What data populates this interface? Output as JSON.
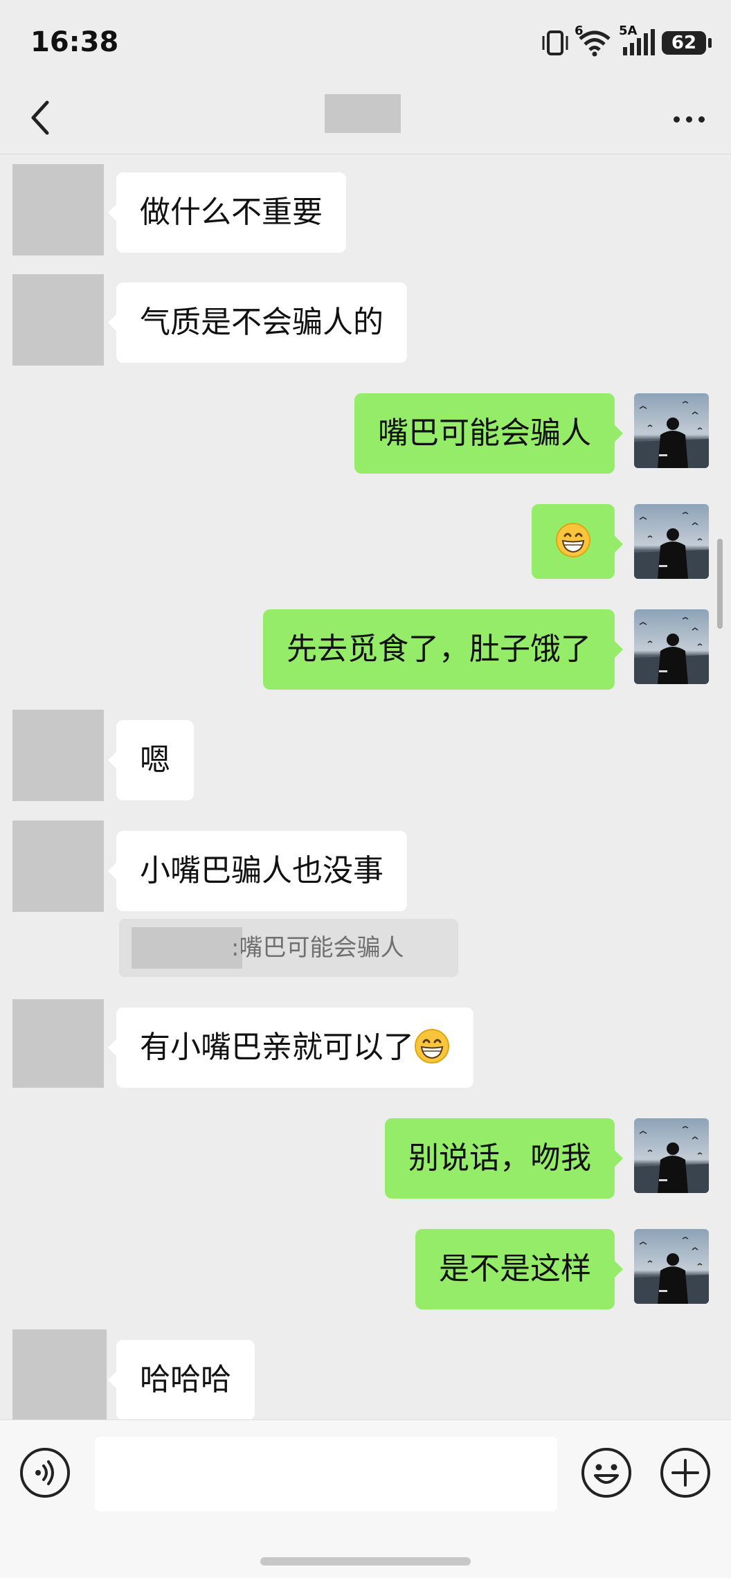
{
  "status_bar": {
    "time": "16:38",
    "network_label": "5A",
    "wifi_label": "6",
    "battery": "62"
  },
  "nav": {
    "back_icon": "chevron-left-icon",
    "more_icon": "more-dots-icon"
  },
  "messages": [
    {
      "side": "left",
      "text": "做什么不重要"
    },
    {
      "side": "left",
      "text": "气质是不会骗人的"
    },
    {
      "side": "right",
      "text": "嘴巴可能会骗人"
    },
    {
      "side": "right",
      "text": "",
      "emoji": "grinning-face-emoji"
    },
    {
      "side": "right",
      "text": "先去觅食了，肚子饿了"
    },
    {
      "side": "left",
      "text": "嗯"
    },
    {
      "side": "left",
      "text": "小嘴巴骗人也没事",
      "quote": ":嘴巴可能会骗人"
    },
    {
      "side": "left",
      "text": "有小嘴巴亲就可以了",
      "emoji": "grinning-face-emoji"
    },
    {
      "side": "right",
      "text": "别说话，吻我"
    },
    {
      "side": "right",
      "text": "是不是这样"
    },
    {
      "side": "left",
      "text": "哈哈哈"
    }
  ],
  "input_bar": {
    "voice_icon": "voice-icon",
    "emoji_icon": "smiley-icon",
    "plus_icon": "plus-circle-icon",
    "text_value": ""
  },
  "colors": {
    "background": "#ededed",
    "self_bubble": "#95ec69",
    "other_bubble": "#ffffff",
    "redaction": "#c8c8c8"
  }
}
